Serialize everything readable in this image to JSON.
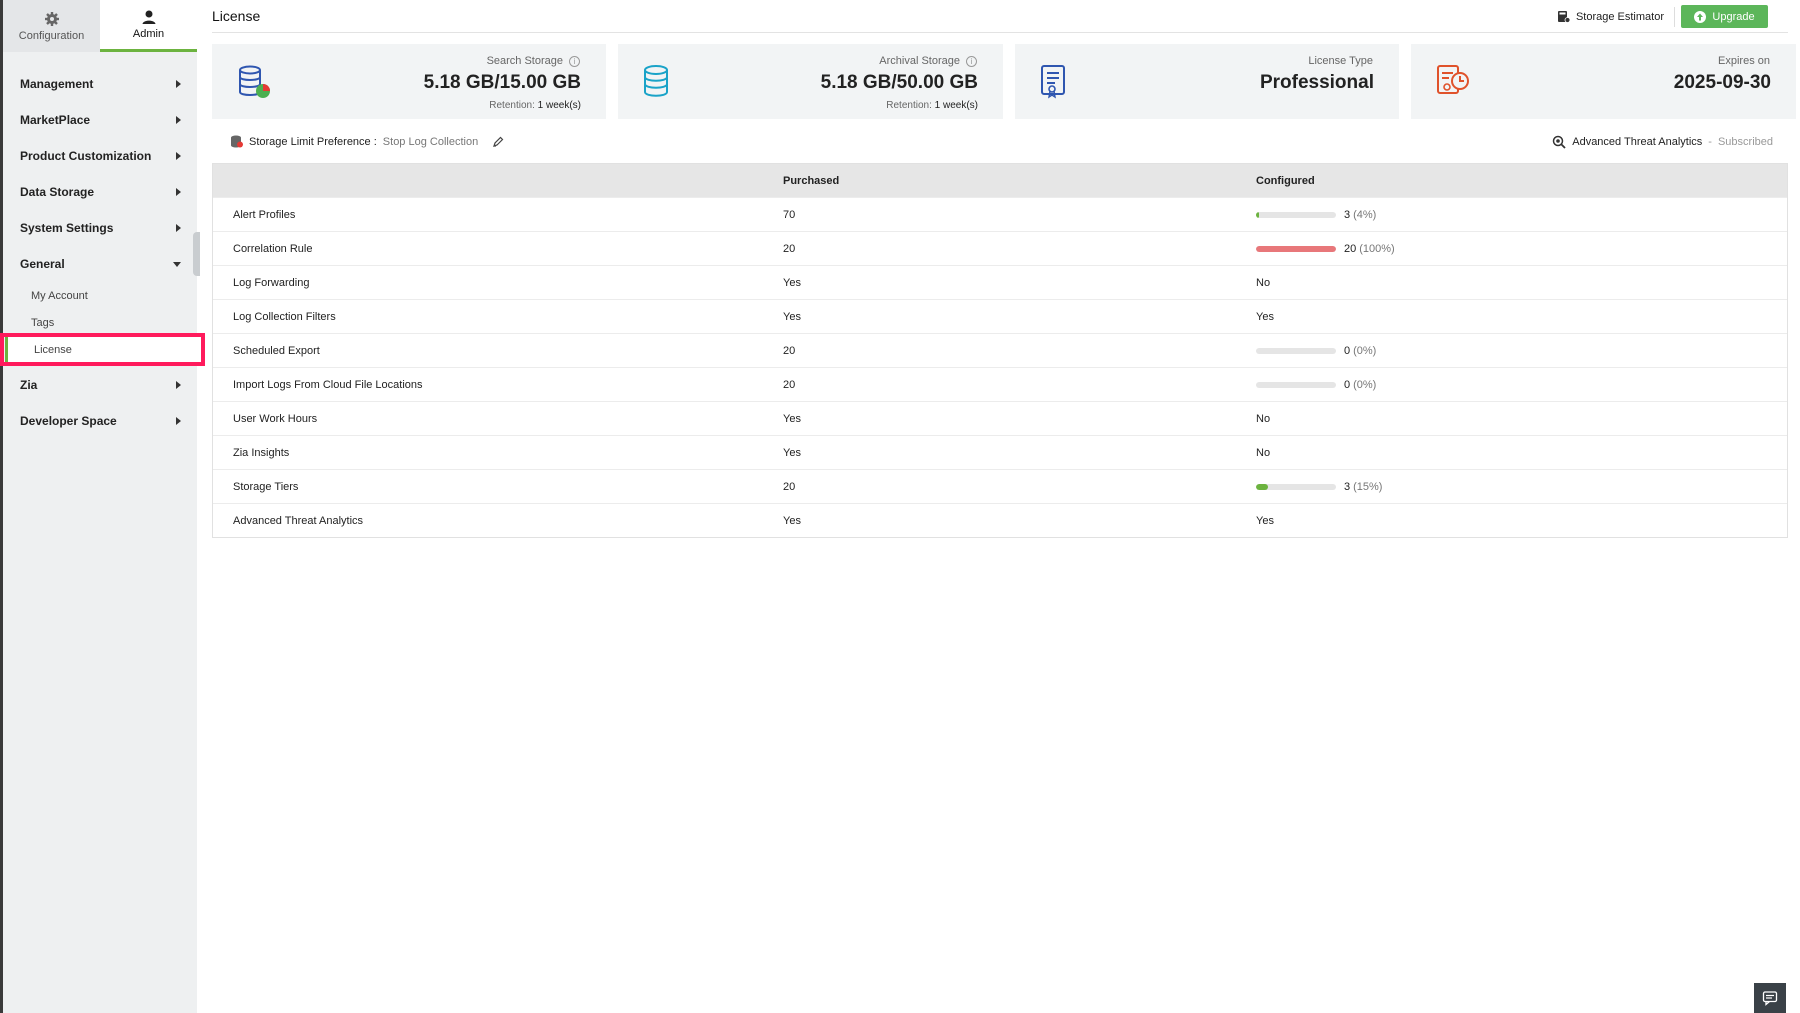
{
  "sidebar": {
    "tabs": [
      {
        "label": "Configuration",
        "icon": "gear-icon",
        "active": false
      },
      {
        "label": "Admin",
        "icon": "user-icon",
        "active": true
      }
    ],
    "items": [
      {
        "label": "Management"
      },
      {
        "label": "MarketPlace"
      },
      {
        "label": "Product Customization"
      },
      {
        "label": "Data Storage"
      },
      {
        "label": "System Settings"
      },
      {
        "label": "General",
        "expanded": true
      },
      {
        "label": "Zia"
      },
      {
        "label": "Developer Space"
      }
    ],
    "general_sub": [
      {
        "label": "My Account"
      },
      {
        "label": "Tags"
      },
      {
        "label": "License",
        "active": true
      }
    ]
  },
  "header": {
    "title": "License",
    "storage_estimator": "Storage Estimator",
    "upgrade": "Upgrade"
  },
  "cards": {
    "search": {
      "label": "Search Storage",
      "value": "5.18 GB/15.00 GB",
      "retention_label": "Retention:",
      "retention_value": "1 week(s)"
    },
    "archival": {
      "label": "Archival Storage",
      "value": "5.18 GB/50.00 GB",
      "retention_label": "Retention:",
      "retention_value": "1 week(s)"
    },
    "license_type": {
      "label": "License Type",
      "value": "Professional"
    },
    "expires": {
      "label": "Expires on",
      "value": "2025-09-30"
    }
  },
  "preference": {
    "label": "Storage Limit Preference :",
    "value": "Stop Log Collection",
    "ata_label": "Advanced Threat Analytics",
    "ata_sep": "-",
    "ata_status": "Subscribed"
  },
  "table": {
    "headers": [
      "",
      "Purchased",
      "Configured"
    ],
    "rows": [
      {
        "name": "Alert Profiles",
        "purchased": "70",
        "configured": "3",
        "pct": "(4%)",
        "fraction": 0.04,
        "color": "#6cb33f"
      },
      {
        "name": "Correlation Rule",
        "purchased": "20",
        "configured": "20",
        "pct": "(100%)",
        "fraction": 1.0,
        "color": "#e8777a"
      },
      {
        "name": "Log Forwarding",
        "purchased": "Yes",
        "configured": "No"
      },
      {
        "name": "Log Collection Filters",
        "purchased": "Yes",
        "configured": "Yes"
      },
      {
        "name": "Scheduled Export",
        "purchased": "20",
        "configured": "0",
        "pct": "(0%)",
        "fraction": 0.0,
        "color": "#6cb33f"
      },
      {
        "name": "Import Logs From Cloud File Locations",
        "purchased": "20",
        "configured": "0",
        "pct": "(0%)",
        "fraction": 0.0,
        "color": "#6cb33f"
      },
      {
        "name": "User Work Hours",
        "purchased": "Yes",
        "configured": "No"
      },
      {
        "name": "Zia Insights",
        "purchased": "Yes",
        "configured": "No"
      },
      {
        "name": "Storage Tiers",
        "purchased": "20",
        "configured": "3",
        "pct": "(15%)",
        "fraction": 0.15,
        "color": "#6cb33f"
      },
      {
        "name": "Advanced Threat Analytics",
        "purchased": "Yes",
        "configured": "Yes"
      }
    ]
  },
  "colors": {
    "accent_green": "#6cb33f",
    "upgrade_green": "#5cb65a",
    "highlight": "#ff1a5c",
    "danger_bar": "#e8777a"
  }
}
